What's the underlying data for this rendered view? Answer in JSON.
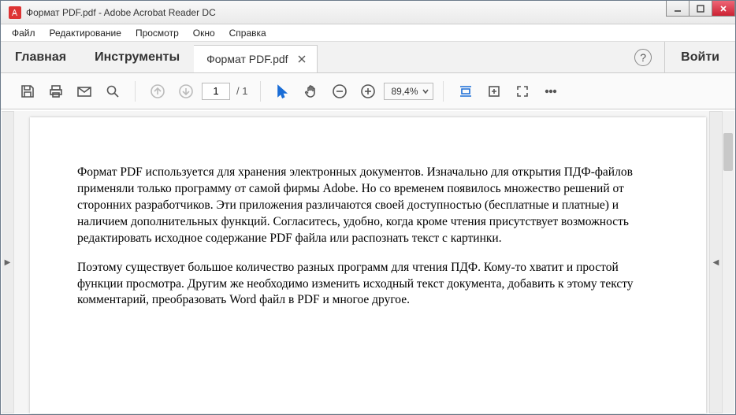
{
  "window": {
    "title": "Формат PDF.pdf - Adobe Acrobat Reader DC"
  },
  "menu": {
    "file": "Файл",
    "edit": "Редактирование",
    "view": "Просмотр",
    "window": "Окно",
    "help": "Справка"
  },
  "tabs": {
    "home": "Главная",
    "tools": "Инструменты",
    "doc": "Формат PDF.pdf",
    "login": "Войти"
  },
  "toolbar": {
    "page_current": "1",
    "page_total": "/ 1",
    "zoom": "89,4%"
  },
  "document": {
    "p1": "Формат PDF используется для хранения электронных документов. Изначально для открытия ПДФ-файлов применяли только программу от самой фирмы Adobe. Но со временем появилось множество решений от сторонних разработчиков. Эти приложения различаются своей доступностью (бесплатные и платные) и наличием дополнительных функций. Согласитесь, удобно, когда кроме чтения присутствует возможность редактировать исходное содержание PDF файла или распознать текст с картинки.",
    "p2": "Поэтому существует большое количество разных программ для чтения ПДФ. Кому-то хватит и простой функции просмотра. Другим же необходимо изменить исходный текст документа, добавить к этому тексту комментарий, преобразовать Word файл в PDF и многое другое."
  }
}
